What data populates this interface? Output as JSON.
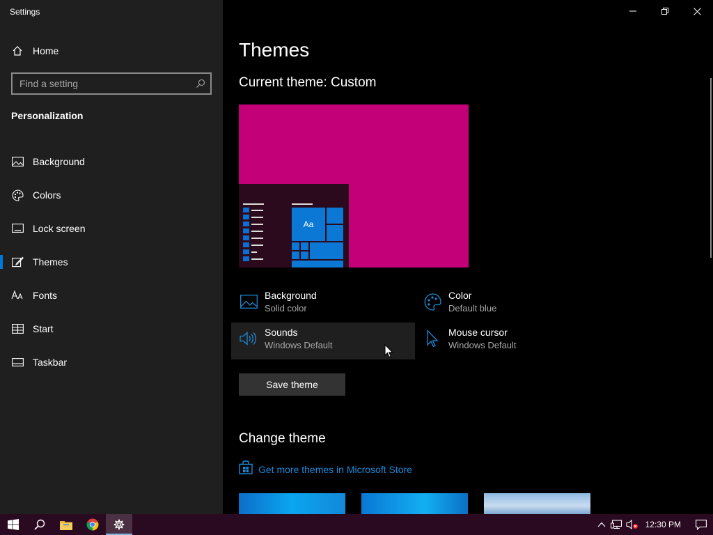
{
  "window": {
    "title": "Settings"
  },
  "sidebar": {
    "home_label": "Home",
    "search_placeholder": "Find a setting",
    "section_title": "Personalization",
    "items": [
      {
        "label": "Background",
        "icon": "image-icon"
      },
      {
        "label": "Colors",
        "icon": "palette-icon"
      },
      {
        "label": "Lock screen",
        "icon": "lock-screen-icon"
      },
      {
        "label": "Themes",
        "icon": "brush-icon",
        "selected": true
      },
      {
        "label": "Fonts",
        "icon": "fonts-icon"
      },
      {
        "label": "Start",
        "icon": "start-icon"
      },
      {
        "label": "Taskbar",
        "icon": "taskbar-icon"
      }
    ]
  },
  "main": {
    "page_title": "Themes",
    "current_theme": "Current theme: Custom",
    "preview": {
      "tile_text": "Aa",
      "background_color": "#c40079",
      "accent_color": "#0a78d4"
    },
    "properties": {
      "background": {
        "title": "Background",
        "value": "Solid color"
      },
      "color": {
        "title": "Color",
        "value": "Default blue"
      },
      "sounds": {
        "title": "Sounds",
        "value": "Windows Default"
      },
      "mouse_cursor": {
        "title": "Mouse cursor",
        "value": "Windows Default"
      }
    },
    "save_button": "Save theme",
    "change_theme_heading": "Change theme",
    "store_link": "Get more themes in Microsoft Store"
  },
  "taskbar": {
    "clock": "12:30 PM",
    "apps": [
      "start-icon",
      "search-icon",
      "file-explorer-icon",
      "chrome-icon",
      "settings-icon"
    ]
  },
  "colors": {
    "accent": "#0078d7",
    "link": "#1a8ad8",
    "sidebar_bg": "#1f1f1f",
    "taskbar_bg": "#2a0a20"
  }
}
